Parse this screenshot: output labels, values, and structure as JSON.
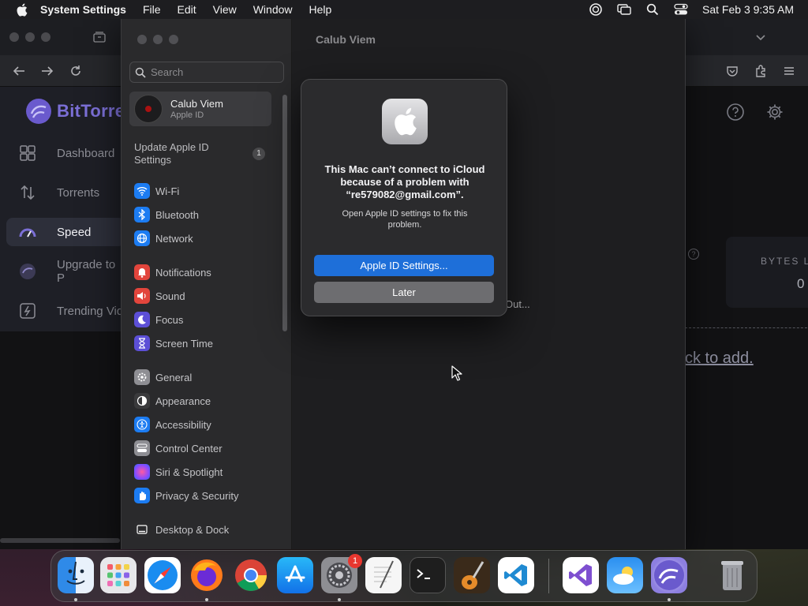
{
  "menubar": {
    "apple_icon": "apple-logo-icon",
    "app_name": "System Settings",
    "items": [
      "File",
      "Edit",
      "View",
      "Window",
      "Help"
    ],
    "status_icons": [
      "creative-cloud-icon",
      "screen-mirroring-icon",
      "spotlight-search-icon",
      "control-center-icon"
    ],
    "clock": "Sat Feb 3  9:35 AM"
  },
  "browser": {
    "app": "BitTorrent",
    "logo_text": "BitTorre",
    "nav": [
      {
        "label": "Dashboard",
        "icon": "dashboard-icon"
      },
      {
        "label": "Torrents",
        "icon": "torrents-arrows-icon"
      },
      {
        "label": "Speed",
        "icon": "speed-gauge-icon"
      },
      {
        "label": "Upgrade to P",
        "icon": "upgrade-icon"
      },
      {
        "label": "Trending Vid",
        "icon": "trending-video-icon"
      }
    ],
    "active_nav": "Speed",
    "card_label": "BYTES L",
    "card_value": "0",
    "help_mark": "?",
    "add_link": "ck to add."
  },
  "settings": {
    "search_placeholder": "Search",
    "account": {
      "name": "Calub Viem",
      "subtitle": "Apple ID"
    },
    "update_notice": "Update Apple ID Settings",
    "update_badge": "1",
    "sidebar_items": [
      {
        "label": "Wi-Fi",
        "icon": "wifi-icon",
        "color": "#1c7cf2"
      },
      {
        "label": "Bluetooth",
        "icon": "bluetooth-icon",
        "color": "#1c7cf2"
      },
      {
        "label": "Network",
        "icon": "network-globe-icon",
        "color": "#1c7cf2"
      },
      {
        "label": "Notifications",
        "icon": "notifications-bell-icon",
        "color": "#e2453c"
      },
      {
        "label": "Sound",
        "icon": "sound-speaker-icon",
        "color": "#e2453c"
      },
      {
        "label": "Focus",
        "icon": "focus-moon-icon",
        "color": "#5c4fd6"
      },
      {
        "label": "Screen Time",
        "icon": "screen-time-hourglass-icon",
        "color": "#5c4fd6"
      },
      {
        "label": "General",
        "icon": "general-gear-icon",
        "color": "#8e8e93"
      },
      {
        "label": "Appearance",
        "icon": "appearance-icon",
        "color": "#3a3a3c"
      },
      {
        "label": "Accessibility",
        "icon": "accessibility-icon",
        "color": "#1c7cf2"
      },
      {
        "label": "Control Center",
        "icon": "control-center-icon",
        "color": "#8e8e93"
      },
      {
        "label": "Siri & Spotlight",
        "icon": "siri-icon",
        "color": "#c04ad8"
      },
      {
        "label": "Privacy & Security",
        "icon": "privacy-hand-icon",
        "color": "#1c7cf2"
      },
      {
        "label": "Desktop & Dock",
        "icon": "desktop-dock-icon",
        "color": "#2c2c2e"
      }
    ],
    "main_title": "Calub Viem",
    "behind_text": "Out..."
  },
  "alert": {
    "icon": "apple-logo-icon",
    "title": "This Mac can’t connect to iCloud because of a problem with “re579082@gmail.com”.",
    "message": "Open Apple ID settings to fix this problem.",
    "primary_button": "Apple ID Settings...",
    "secondary_button": "Later",
    "accent": "#1e6fd9"
  },
  "dock": {
    "apps": [
      {
        "name": "Finder",
        "icon": "finder-icon",
        "running": true
      },
      {
        "name": "Launchpad",
        "icon": "launchpad-icon",
        "running": false
      },
      {
        "name": "Safari",
        "icon": "safari-icon",
        "running": false
      },
      {
        "name": "Firefox",
        "icon": "firefox-icon",
        "running": true
      },
      {
        "name": "Chrome",
        "icon": "chrome-icon",
        "running": false
      },
      {
        "name": "App Store",
        "icon": "app-store-icon",
        "running": false
      },
      {
        "name": "System Settings",
        "icon": "system-settings-icon",
        "running": true,
        "badge": "1"
      },
      {
        "name": "TextEdit",
        "icon": "textedit-icon",
        "running": false
      },
      {
        "name": "Terminal",
        "icon": "terminal-icon",
        "running": false
      },
      {
        "name": "GarageBand",
        "icon": "garageband-icon",
        "running": false
      },
      {
        "name": "Visual Studio Code",
        "icon": "vscode-icon",
        "running": false
      },
      {
        "name": "Visual Studio",
        "icon": "visual-studio-icon",
        "running": false
      },
      {
        "name": "Weather",
        "icon": "weather-icon",
        "running": false
      },
      {
        "name": "BitTorrent",
        "icon": "bittorrent-icon",
        "running": true
      },
      {
        "name": "Trash",
        "icon": "trash-icon",
        "running": false
      }
    ]
  }
}
